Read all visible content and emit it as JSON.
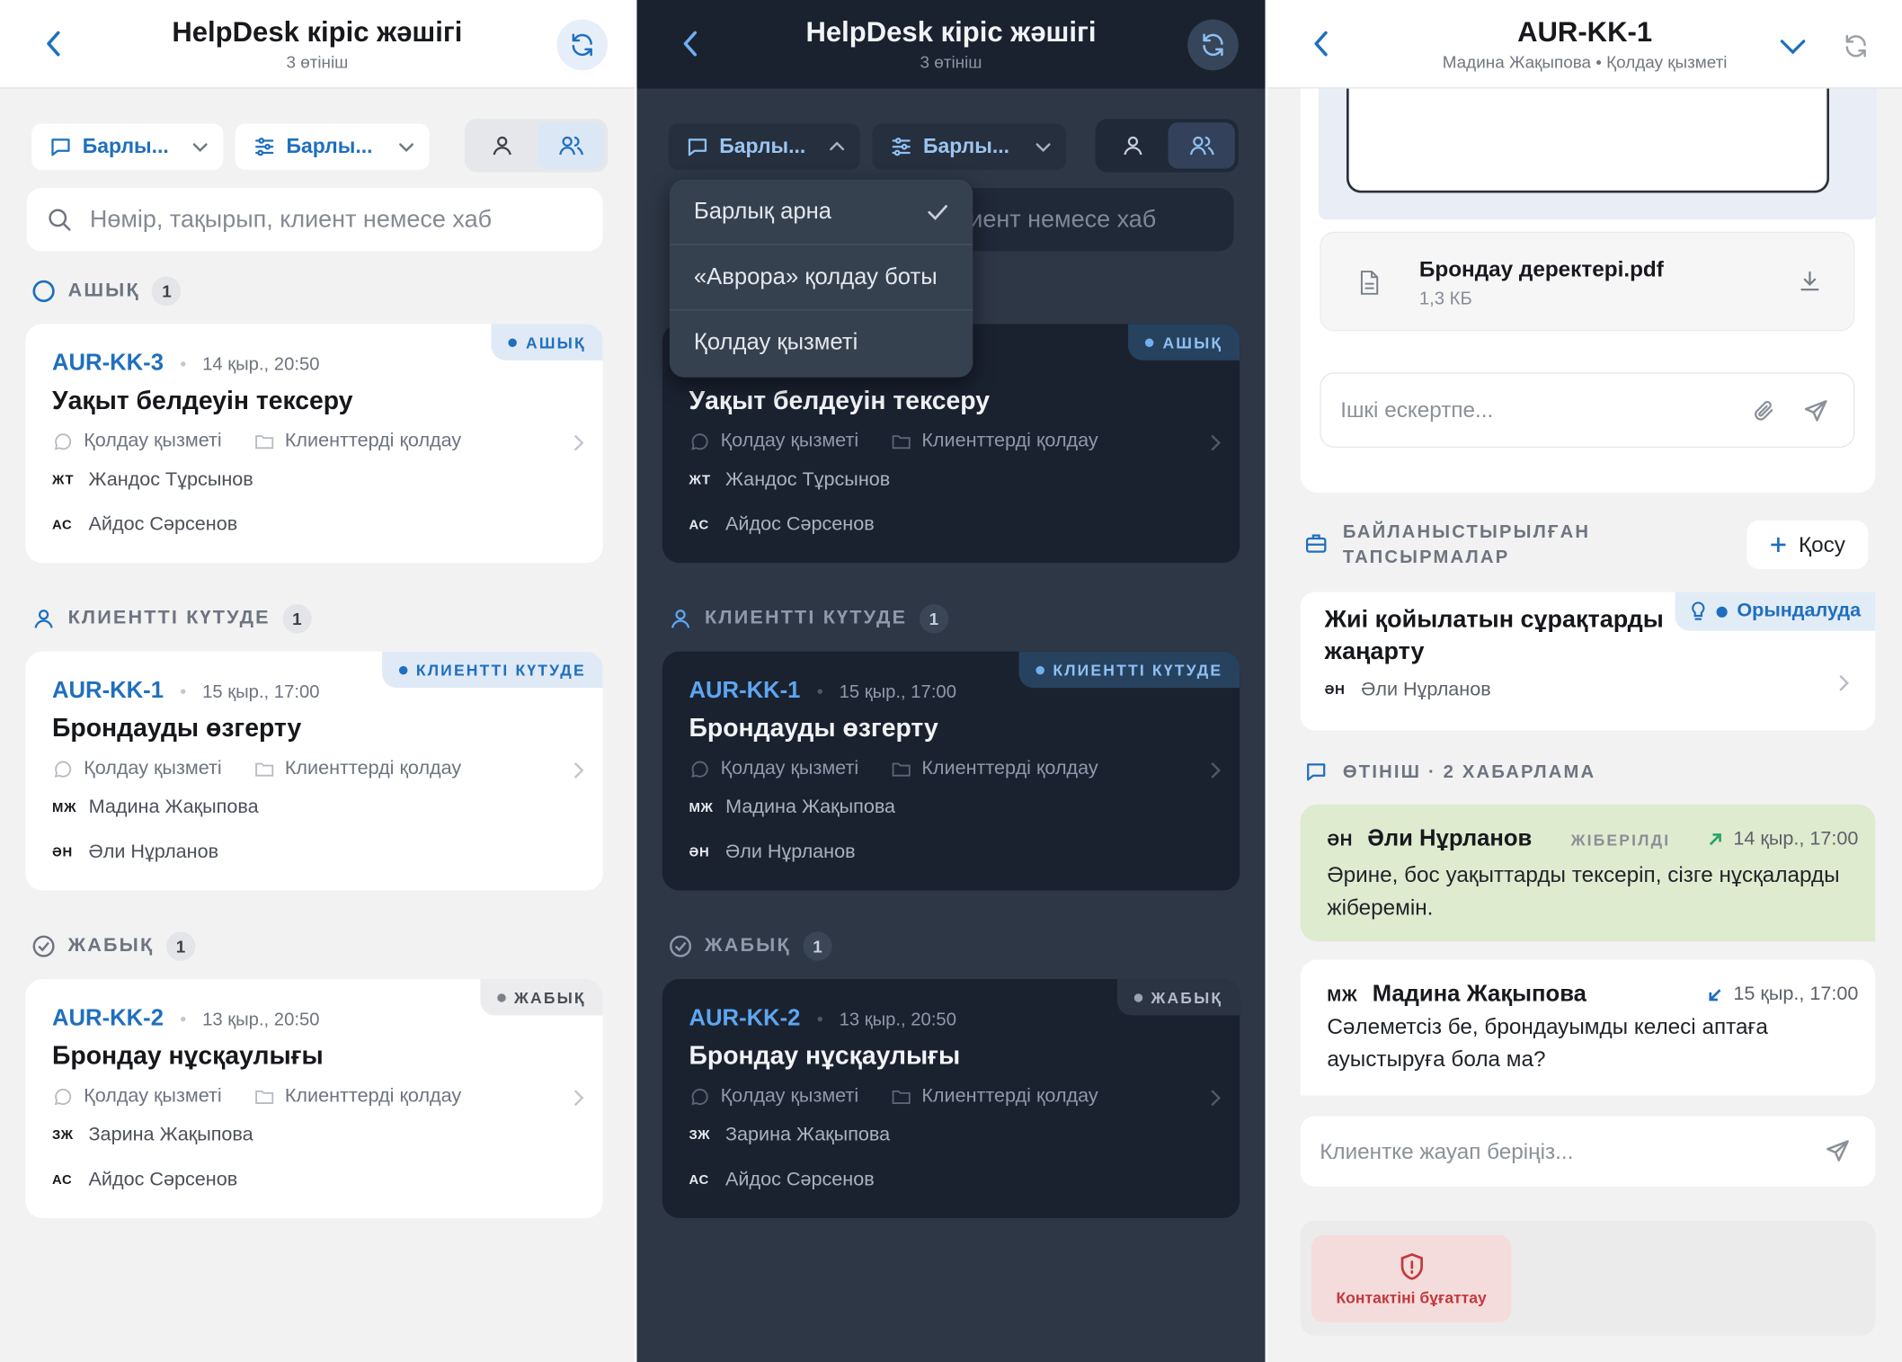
{
  "inbox": {
    "title": "HelpDesk кіріс жәшігі",
    "subtitle": "3 өтініш",
    "filter_channel": "Барлы...",
    "filter_settings": "Барлы...",
    "search_placeholder": "Нөмір, тақырып, клиент немесе хаб",
    "sections": [
      {
        "label": "АШЫҚ",
        "count": "1"
      },
      {
        "label": "КЛИЕНТТІ КҮТУДЕ",
        "count": "1"
      },
      {
        "label": "ЖАБЫҚ",
        "count": "1"
      }
    ],
    "tickets": [
      {
        "id": "AUR-KK-3",
        "time": "14 қыр., 20:50",
        "title": "Уақыт белдеуін тексеру",
        "channel": "Қолдау қызметі",
        "group": "Клиенттерді қолдау",
        "client_ini": "ЖТ",
        "client": "Жандос Тұрсынов",
        "agent_ini": "АС",
        "agent": "Айдос Сәрсенов",
        "badge": "АШЫҚ"
      },
      {
        "id": "AUR-KK-1",
        "time": "15 қыр., 17:00",
        "title": "Брондауды өзгерту",
        "channel": "Қолдау қызметі",
        "group": "Клиенттерді қолдау",
        "client_ini": "МЖ",
        "client": "Мадина Жақыпова",
        "agent_ini": "ӘН",
        "agent": "Әли Нұрланов",
        "badge": "КЛИЕНТТІ КҮТУДЕ"
      },
      {
        "id": "AUR-KK-2",
        "time": "13 қыр., 20:50",
        "title": "Брондау нұсқаулығы",
        "channel": "Қолдау қызметі",
        "group": "Клиенттерді қолдау",
        "client_ini": "ЗЖ",
        "client": "Зарина Жақыпова",
        "agent_ini": "АС",
        "agent": "Айдос Сәрсенов",
        "badge": "ЖАБЫҚ"
      }
    ]
  },
  "dropdown": {
    "options": [
      "Барлық арна",
      "«Аврора» қолдау боты",
      "Қолдау қызметі"
    ],
    "selected": "Барлық арна"
  },
  "search_visible_dark": "иент немесе хаб",
  "detail": {
    "title": "AUR-KK-1",
    "subtitle": "Мадина Жақыпова • Қолдау қызметі",
    "file_name": "Брондау деректері.pdf",
    "file_size": "1,3 КБ",
    "note_placeholder": "Ішкі ескертпе...",
    "linked_tasks_label": "БАЙЛАНЫСТЫРЫЛҒАН ТАПСЫРМАЛАР",
    "add_label": "Қосу",
    "task": {
      "title": "Жиі қойылатын сұрақтарды жаңарту",
      "status": "Орындалуда",
      "assignee_ini": "ӘН",
      "assignee": "Әли Нұрланов"
    },
    "messages_label": "ӨТІНІШ · 2 ХАБАРЛАМА",
    "messages": [
      {
        "ini": "ӘН",
        "name": "Әли Нұрланов",
        "state": "ЖІБЕРІЛДІ",
        "time": "14 қыр., 17:00",
        "text": "Әрине, бос уақыттарды тексеріп, сізге нұсқаларды жіберемін."
      },
      {
        "ini": "МЖ",
        "name": "Мадина Жақыпова",
        "state": "",
        "time": "15 қыр., 17:00",
        "text": "Сәлеметсіз бе, брондауымды келесі аптаға ауыстыруға бола ма?"
      }
    ],
    "reply_placeholder": "Клиентке жауап беріңіз...",
    "block_label": "Контактіні бұғаттау"
  },
  "colors": {
    "accent": "#1f6fbe",
    "dark_bg": "#2d3746",
    "out_bubble": "#deebcf",
    "danger": "#c2393b"
  }
}
